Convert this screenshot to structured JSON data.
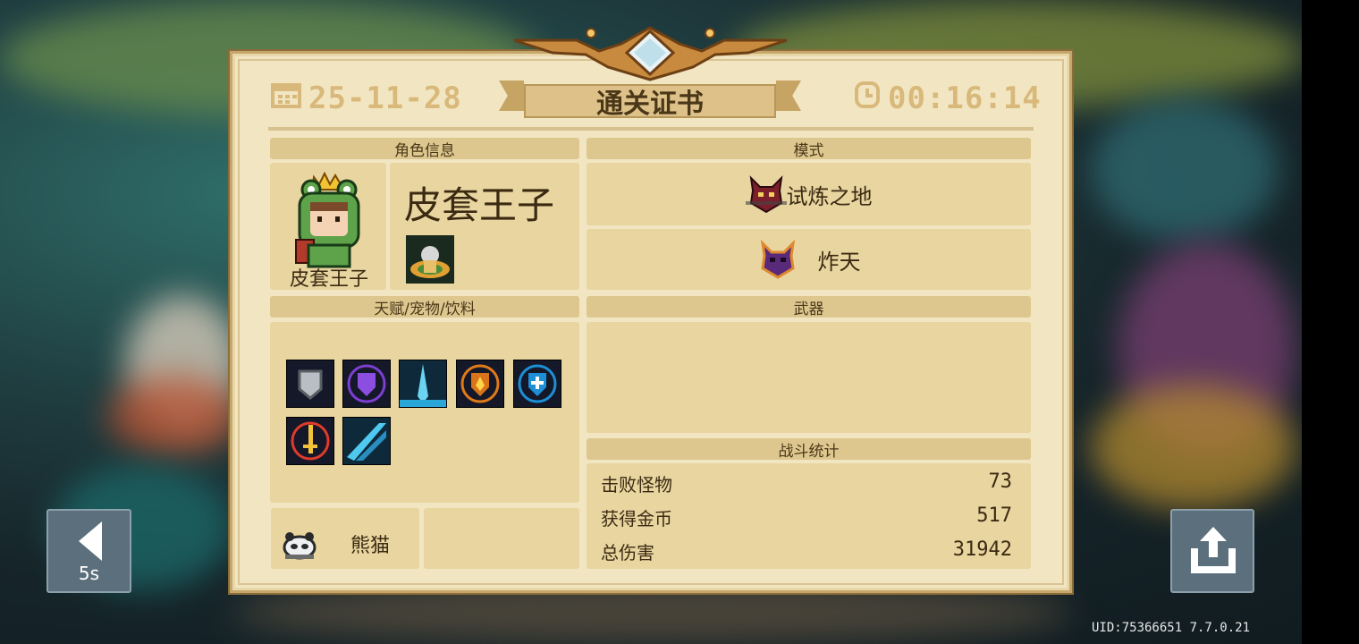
{
  "header": {
    "date": "25-11-28",
    "title": "通关证书",
    "time": "00:16:14"
  },
  "character": {
    "section_label": "角色信息",
    "name_small": "皮套王子",
    "name_big": "皮套王子"
  },
  "mode": {
    "section_label": "模式",
    "items": [
      {
        "label": "试炼之地",
        "icon": "demon-horned-icon"
      },
      {
        "label": "炸天",
        "icon": "demon-horned-purple-icon"
      }
    ]
  },
  "talents": {
    "section_label": "天赋/宠物/饮料",
    "icons": [
      "shield-gray-icon",
      "shield-purple-icon",
      "arrow-blue-icon",
      "shield-fire-icon",
      "shield-cross-icon",
      "sword-red-icon",
      "diagonal-blade-icon"
    ]
  },
  "pet": {
    "name": "熊猫",
    "icon": "panda-icon"
  },
  "weapons": {
    "section_label": "武器"
  },
  "stats": {
    "section_label": "战斗统计",
    "rows": [
      {
        "label": "击败怪物",
        "value": "73"
      },
      {
        "label": "获得金币",
        "value": "517"
      },
      {
        "label": "总伤害",
        "value": "31942"
      }
    ]
  },
  "controls": {
    "back_countdown": "5s",
    "share_icon": "share-icon"
  },
  "footer": {
    "uid": "UID:75366651 7.7.0.21"
  },
  "colors": {
    "paper": "#f2e6c2",
    "section": "#ddc78f",
    "panel": "#e8d5a0",
    "gold_text": "#d9b97b",
    "button": "#5b6f7c"
  }
}
